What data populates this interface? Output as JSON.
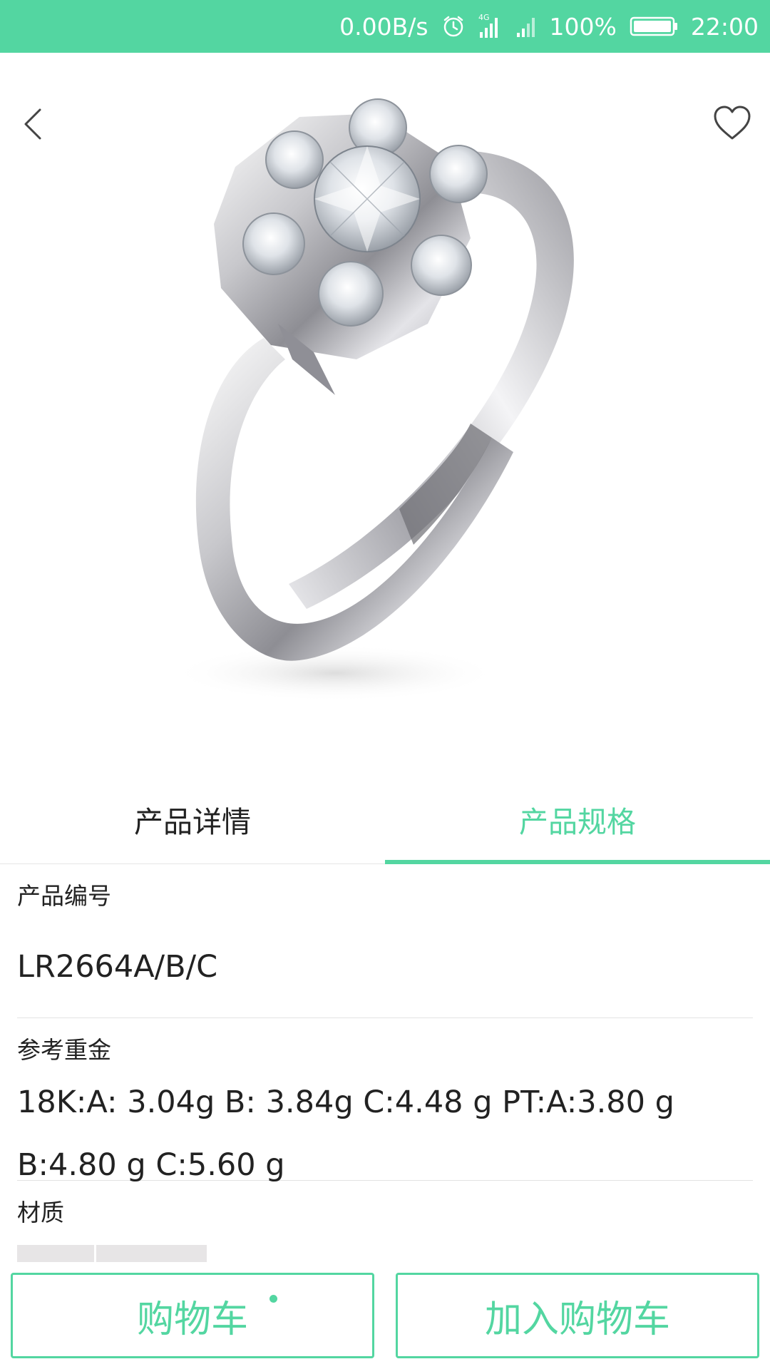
{
  "status_bar": {
    "network_speed": "0.00B/s",
    "battery_percent": "100%",
    "time": "22:00",
    "icons": [
      "alarm-icon",
      "signal-4g-icon",
      "signal-icon",
      "battery-icon"
    ]
  },
  "hero": {
    "image_subject": "ring-product-image",
    "back_icon": "chevron-left-icon",
    "favorite_icon": "heart-outline-icon"
  },
  "tabs": [
    {
      "label": "产品详情",
      "active": false
    },
    {
      "label": "产品规格",
      "active": true
    }
  ],
  "specs": [
    {
      "label": "产品编号",
      "value": "LR2664A/B/C"
    },
    {
      "label": "参考重金",
      "value_line1": "18K:A: 3.04g B: 3.84g C:4.48 g PT:A:3.80 g",
      "value_line2": "B:4.80 g C:5.60 g"
    },
    {
      "label": "材质"
    }
  ],
  "actions": {
    "cart_label": "购物车",
    "add_to_cart_label": "加入购物车"
  },
  "colors": {
    "accent": "#53d6a1",
    "text": "#222222",
    "divider": "#e3e3e3"
  }
}
